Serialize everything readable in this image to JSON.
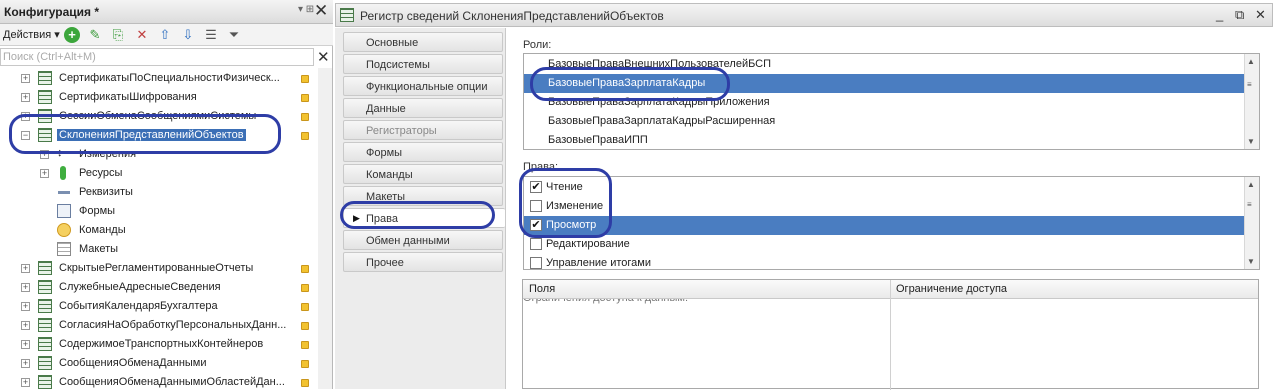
{
  "left_panel": {
    "title": "Конфигурация *",
    "pin": "▾ ⊞",
    "close": "✕",
    "actions_label": "Действия",
    "search_placeholder": "Поиск (Ctrl+Alt+M)",
    "search_clear": "✕",
    "tree": [
      {
        "label": "СертификатыПоСпециальностиФизическ...",
        "type": "register",
        "expander": "+"
      },
      {
        "label": "СертификатыШифрования",
        "type": "register",
        "expander": "+"
      },
      {
        "label": "СессииОбменаСообщениямиСистемы",
        "type": "register",
        "expander": "+"
      },
      {
        "label": "СклоненияПредставленийОбъектов",
        "type": "register",
        "expander": "−",
        "selected": true
      },
      {
        "label": "Измерения",
        "type": "dimension",
        "expander": "+"
      },
      {
        "label": "Ресурсы",
        "type": "resource",
        "expander": "+"
      },
      {
        "label": "Реквизиты",
        "type": "attribute"
      },
      {
        "label": "Формы",
        "type": "forms"
      },
      {
        "label": "Команды",
        "type": "commands"
      },
      {
        "label": "Макеты",
        "type": "templates"
      },
      {
        "label": "СкрытыеРегламентированныеОтчеты",
        "type": "register",
        "expander": "+"
      },
      {
        "label": "СлужебныеАдресныеСведения",
        "type": "register",
        "expander": "+"
      },
      {
        "label": "СобытияКалендаряБухгалтера",
        "type": "register",
        "expander": "+"
      },
      {
        "label": "СогласияНаОбработкуПерсональныхДанн...",
        "type": "register",
        "expander": "+"
      },
      {
        "label": "СодержимоеТранспортныхКонтейнеров",
        "type": "register",
        "expander": "+"
      },
      {
        "label": "СообщенияОбменаДанными",
        "type": "register",
        "expander": "+"
      },
      {
        "label": "СообщенияОбменаДаннымиОбластейДан...",
        "type": "register",
        "expander": "+"
      }
    ]
  },
  "window": {
    "title": "Регистр сведений СклоненияПредставленийОбъектов",
    "buttons": [
      "_",
      "⧉",
      "✕"
    ],
    "tabs": [
      {
        "label": "Основные"
      },
      {
        "label": "Подсистемы"
      },
      {
        "label": "Функциональные опции"
      },
      {
        "label": "Данные"
      },
      {
        "label": "Регистраторы",
        "disabled": true
      },
      {
        "label": "Формы"
      },
      {
        "label": "Команды"
      },
      {
        "label": "Макеты"
      },
      {
        "label": "Права",
        "active": true
      },
      {
        "label": "Обмен данными"
      },
      {
        "label": "Прочее"
      }
    ],
    "roles_caption": "Роли:",
    "roles": [
      "БазовыеПраваВнешнихПользователейБСП",
      "БазовыеПраваЗарплатаКадры",
      "БазовыеПраваЗарплатаКадрыПриложения",
      "БазовыеПраваЗарплатаКадрыРасширенная",
      "БазовыеПраваИПП"
    ],
    "selected_role_index": 1,
    "rights_caption": "Права:",
    "rights": [
      {
        "label": "Чтение",
        "checked": true
      },
      {
        "label": "Изменение",
        "checked": false
      },
      {
        "label": "Просмотр",
        "checked": true,
        "selected": true
      },
      {
        "label": "Редактирование",
        "checked": false
      },
      {
        "label": "Управление итогами",
        "checked": false
      }
    ],
    "restrictions_caption": "Ограничения доступа к данным:",
    "restrictions_columns": [
      "Поля",
      "Ограничение доступа"
    ]
  },
  "colors": {
    "selection": "#4a7dc1",
    "annotation": "#2e3da6"
  }
}
